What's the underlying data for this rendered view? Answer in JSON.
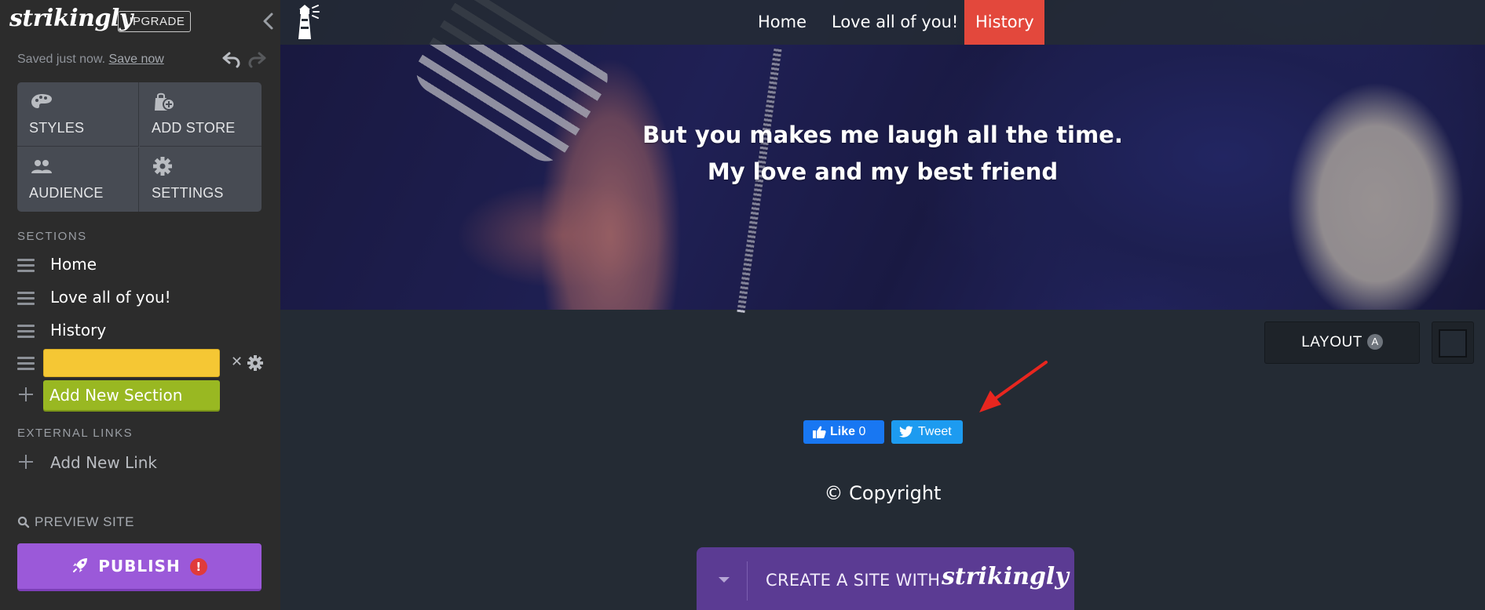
{
  "sidebar": {
    "logo": "strikingly",
    "upgrade_label": "UPGRADE",
    "saved_text": "Saved just now.",
    "save_now_label": "Save now",
    "tiles": [
      {
        "label": "STYLES",
        "icon": "palette-icon"
      },
      {
        "label": "ADD STORE",
        "icon": "store-bag-icon"
      },
      {
        "label": "AUDIENCE",
        "icon": "audience-icon"
      },
      {
        "label": "SETTINGS",
        "icon": "gear-icon"
      }
    ],
    "sections_heading": "SECTIONS",
    "sections": [
      {
        "label": "Home"
      },
      {
        "label": "Love all of you!"
      },
      {
        "label": "History"
      }
    ],
    "new_section_value": "",
    "add_section_label": "Add New Section",
    "external_links_heading": "EXTERNAL LINKS",
    "add_link_label": "Add New Link",
    "preview_label": "PREVIEW SITE",
    "publish_label": "PUBLISH",
    "publish_alert": "!"
  },
  "site": {
    "nav": [
      {
        "label": "Home",
        "active": false
      },
      {
        "label": "Love all of you!",
        "active": false
      },
      {
        "label": "History",
        "active": true
      }
    ],
    "hero_line_1": "But you makes me laugh all the time.",
    "hero_line_2": "My love and my best friend",
    "layout_label": "LAYOUT",
    "layout_badge": "A",
    "facebook_label": "Like",
    "facebook_count": "0",
    "tweet_label": "Tweet",
    "copyright": "© Copyright",
    "create_text": "CREATE A SITE WITH",
    "create_brand": "strikingly"
  },
  "colors": {
    "sidebar_bg": "#2c2c2c",
    "page_bg": "#242b34",
    "nav_active": "#e3483c",
    "section_input": "#f5c734",
    "add_section": "#99b822",
    "publish": "#9b59d9",
    "facebook": "#1877f2",
    "twitter": "#1d9bf0",
    "create_banner": "#5b3b93",
    "annotation_arrow": "#e8261f"
  }
}
